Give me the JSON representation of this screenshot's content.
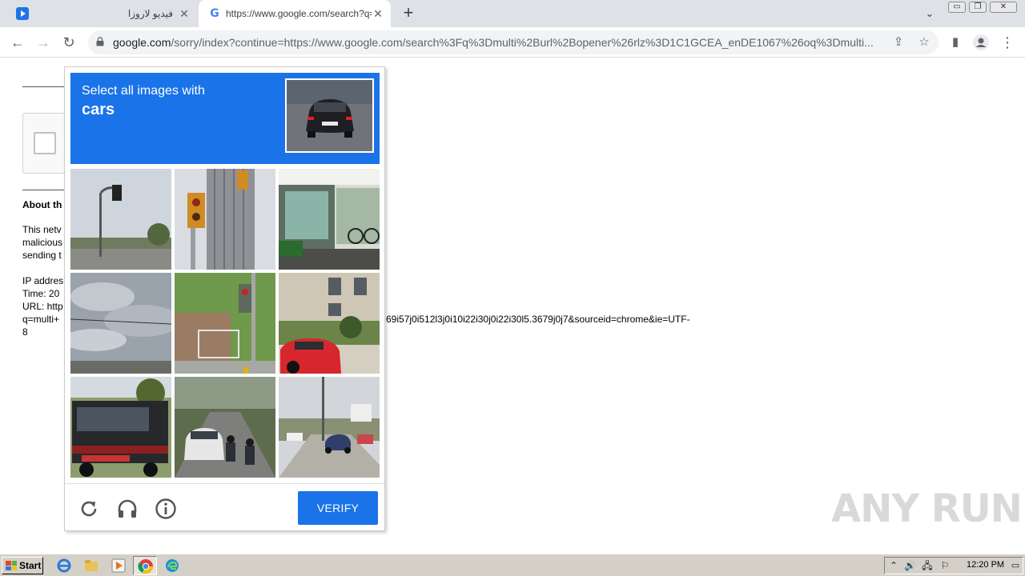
{
  "browser": {
    "tabs": [
      {
        "title": "فيديو لاروزا",
        "active": false,
        "favicon": "play-video-icon"
      },
      {
        "title": "https://www.google.com/search?q=",
        "active": true,
        "favicon": "google-g-icon"
      }
    ],
    "address_host": "google.com",
    "address_rest": "/sorry/index?continue=https://www.google.com/search%3Fq%3Dmulti%2Burl%2Bopener%26rlz%3D1C1GCEA_enDE1067%26oq%3Dmulti...",
    "window_buttons": [
      "▭",
      "❐",
      "✕"
    ]
  },
  "background_page": {
    "about_title": "About th",
    "body_lines": [
      "This netv",
      "malicious",
      "sending t"
    ],
    "ip_lines": [
      "IP addres",
      "Time: 20",
      "URL: http",
      "q=multi+"
    ],
    "url_tail": "69i57j0i512l3j0i10i22i30j0i22i30l5.3679j0j7&sourceid=chrome&ie=UTF-",
    "url_tail2": "8"
  },
  "captcha": {
    "prompt": "Select all images with",
    "target": "cars",
    "verify_label": "VERIFY",
    "accent": "#1a73e8",
    "tiles": [
      {
        "contains_car": false
      },
      {
        "contains_car": false
      },
      {
        "contains_car": false
      },
      {
        "contains_car": false
      },
      {
        "contains_car": false
      },
      {
        "contains_car": true
      },
      {
        "contains_car": true
      },
      {
        "contains_car": true
      },
      {
        "contains_car": true
      }
    ]
  },
  "watermark": "ANY RUN",
  "taskbar": {
    "start_label": "Start",
    "clock": "12:20 PM"
  }
}
